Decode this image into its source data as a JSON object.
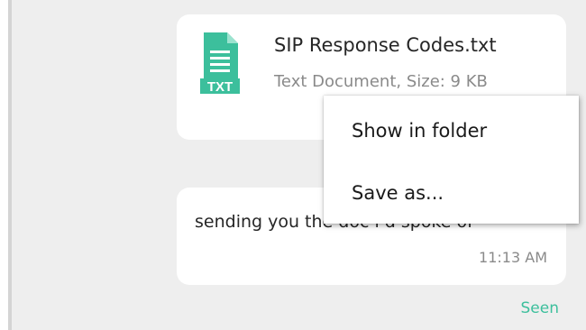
{
  "file_message": {
    "file_name": "SIP Response Codes.txt",
    "file_meta": "Text Document, Size: 9 KB",
    "icon": "txt-file-icon",
    "icon_label": "TXT"
  },
  "text_message": {
    "text": "sending you the doc i’d spoke of",
    "time": "11:13 AM"
  },
  "status": {
    "seen_label": "Seen"
  },
  "context_menu": {
    "items": [
      {
        "label": "Show in folder"
      },
      {
        "label": "Save as..."
      }
    ]
  },
  "colors": {
    "accent": "#3cbf9c",
    "background": "#eeeeee",
    "bubble": "#ffffff"
  }
}
